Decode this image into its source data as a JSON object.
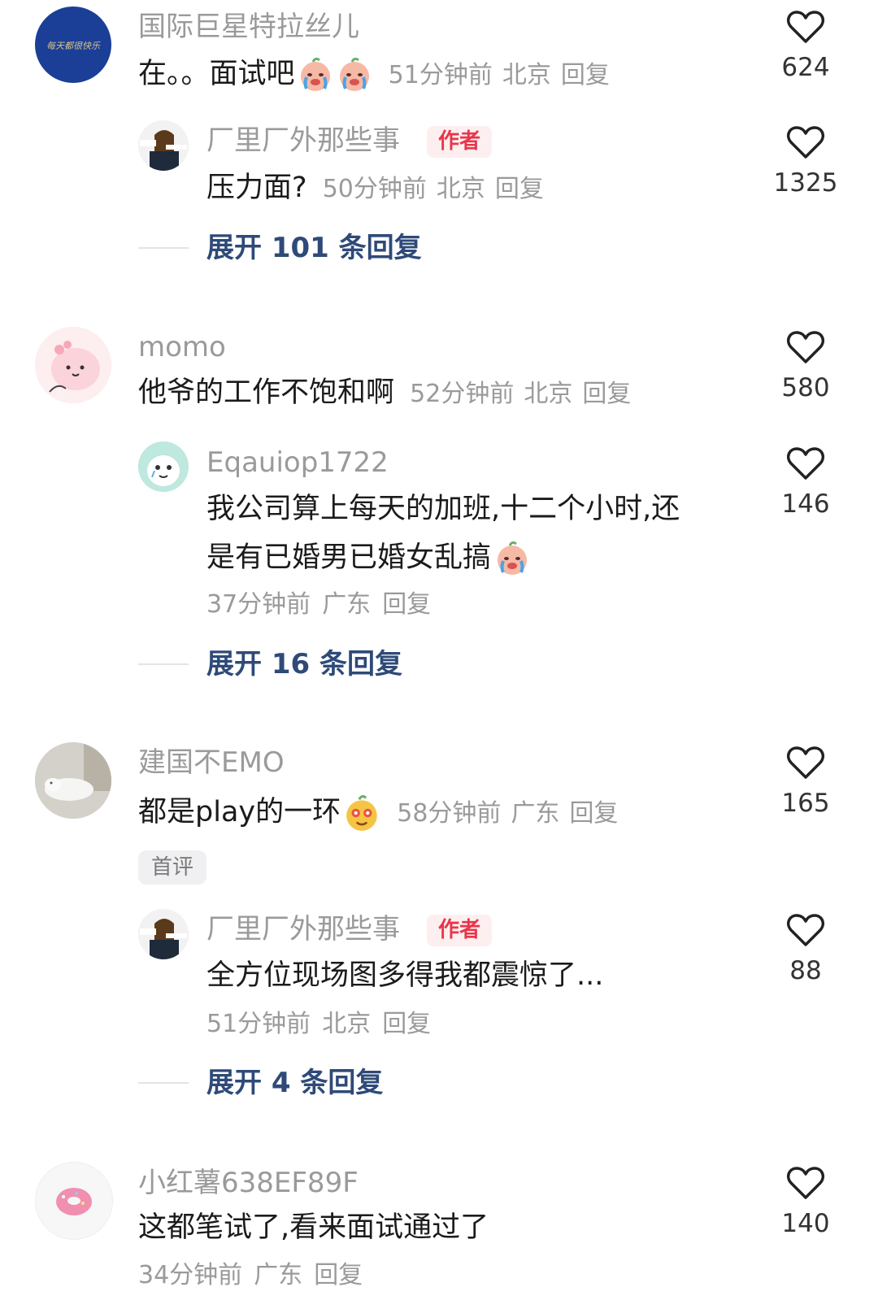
{
  "comments": [
    {
      "username": "国际巨星特拉丝儿",
      "avatar_text": "每天都很快乐",
      "text": "在。。面试吧",
      "emoji": "crying-face-emoji",
      "time": "51分钟前",
      "location": "北京",
      "reply_label": "回复",
      "likes": "624",
      "replies": [
        {
          "username": "厂里厂外那些事",
          "tag": "作者",
          "text": "压力面?",
          "time": "50分钟前",
          "location": "北京",
          "reply_label": "回复",
          "likes": "1325"
        }
      ],
      "expand_label": "展开 101 条回复"
    },
    {
      "username": "momo",
      "text": "他爷的工作不饱和啊",
      "time": "52分钟前",
      "location": "北京",
      "reply_label": "回复",
      "likes": "580",
      "replies": [
        {
          "username": "Eqauiop1722",
          "text_line1": "我公司算上每天的加班,十二个小时,还",
          "text_line2": "是有已婚男已婚女乱搞",
          "emoji": "crying-face-emoji",
          "time": "37分钟前",
          "location": "广东",
          "reply_label": "回复",
          "likes": "146"
        }
      ],
      "expand_label": "展开 16 条回复"
    },
    {
      "username": "建国不EMO",
      "text": "都是play的一环",
      "emoji": "smirk-face-emoji",
      "time": "58分钟前",
      "location": "广东",
      "reply_label": "回复",
      "likes": "165",
      "badge": "首评",
      "replies": [
        {
          "username": "厂里厂外那些事",
          "tag": "作者",
          "text": "全方位现场图多得我都震惊了...",
          "time": "51分钟前",
          "location": "北京",
          "reply_label": "回复",
          "likes": "88"
        }
      ],
      "expand_label": "展开 4 条回复"
    },
    {
      "username": "小红薯638EF89F",
      "text": "这都笔试了,看来面试通过了",
      "time": "34分钟前",
      "location": "广东",
      "reply_label": "回复",
      "likes": "140"
    }
  ],
  "colors": {
    "accent_link": "#2e4a78",
    "author_tag": "#e8364a",
    "muted_text": "#9a9a9a"
  }
}
